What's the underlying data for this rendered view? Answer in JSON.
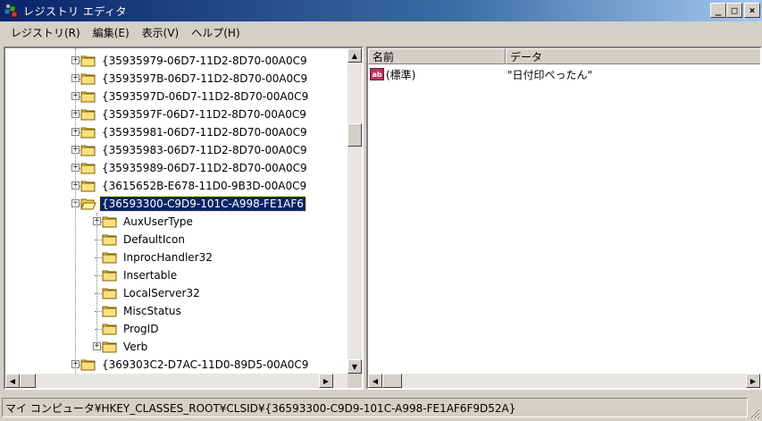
{
  "window": {
    "title": "レジストリ エディタ",
    "minimize": "_",
    "maximize": "□",
    "close": "×"
  },
  "menu": [
    "レジストリ(R)",
    "編集(E)",
    "表示(V)",
    "ヘルプ(H)"
  ],
  "tree": {
    "items": [
      {
        "label": "{35935979-06D7-11D2-8D70-00A0C9",
        "expander": "+"
      },
      {
        "label": "{3593597B-06D7-11D2-8D70-00A0C9",
        "expander": "+"
      },
      {
        "label": "{3593597D-06D7-11D2-8D70-00A0C9",
        "expander": "+"
      },
      {
        "label": "{3593597F-06D7-11D2-8D70-00A0C9",
        "expander": "+"
      },
      {
        "label": "{35935981-06D7-11D2-8D70-00A0C9",
        "expander": "+"
      },
      {
        "label": "{35935983-06D7-11D2-8D70-00A0C9",
        "expander": "+"
      },
      {
        "label": "{35935989-06D7-11D2-8D70-00A0C9",
        "expander": "+"
      },
      {
        "label": "{3615652B-E678-11D0-9B3D-00A0C9",
        "expander": "+"
      },
      {
        "label": "{36593300-C9D9-101C-A998-FE1AF6",
        "expander": "−"
      },
      {
        "label": "AuxUserType",
        "expander": "+"
      },
      {
        "label": "DefaultIcon",
        "expander": ""
      },
      {
        "label": "InprocHandler32",
        "expander": ""
      },
      {
        "label": "Insertable",
        "expander": ""
      },
      {
        "label": "LocalServer32",
        "expander": ""
      },
      {
        "label": "MiscStatus",
        "expander": ""
      },
      {
        "label": "ProgID",
        "expander": ""
      },
      {
        "label": "Verb",
        "expander": "+"
      },
      {
        "label": "{369303C2-D7AC-11D0-89D5-00A0C9",
        "expander": "+"
      }
    ],
    "selected_index": 8
  },
  "list": {
    "headers": {
      "name": "名前",
      "data": "データ"
    },
    "rows": [
      {
        "icon": "ab",
        "name": "(標準)",
        "data": "\"日付印ぺったん\""
      }
    ]
  },
  "status": {
    "path": "マイ コンピュータ¥HKEY_CLASSES_ROOT¥CLSID¥{36593300-C9D9-101C-A998-FE1AF6F9D52A}"
  },
  "colors": {
    "title_start": "#0a246a",
    "selection": "#0a246a",
    "folder": "#f0d060",
    "face": "#d4d0c8"
  },
  "icons": {
    "app": "registry-cubes-icon",
    "folder": "folder-icon",
    "string_value": "ab-string-value-icon"
  }
}
